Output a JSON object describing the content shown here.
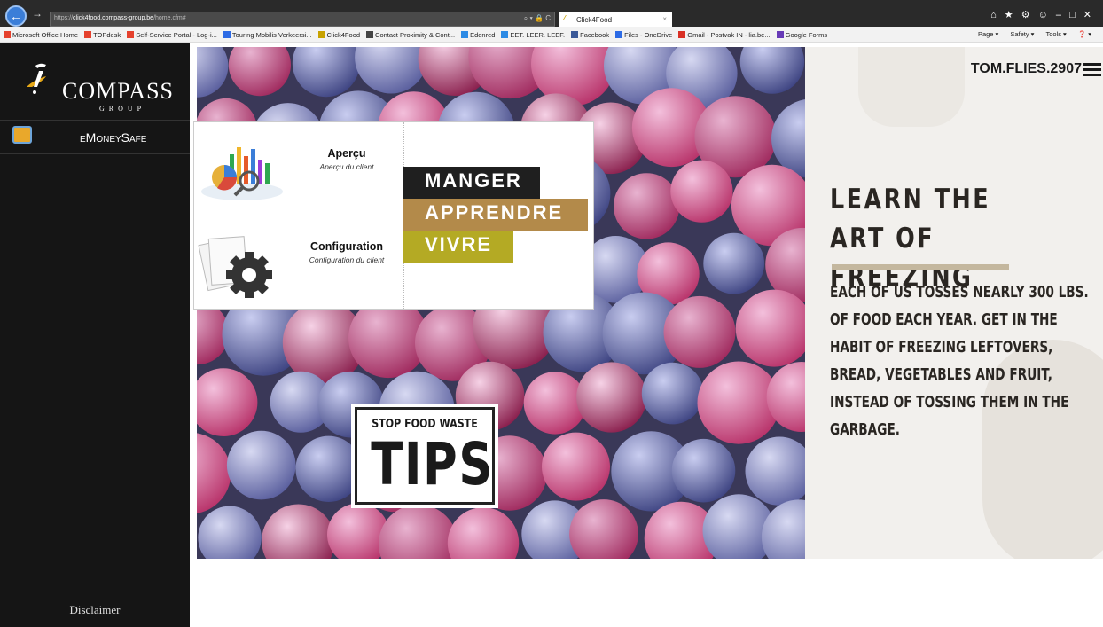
{
  "browser": {
    "address_prefix": "https://",
    "address_host": "click4food.compass-group.be",
    "address_path": "/home.cfm#",
    "address_controls": "⌕ ▾ 🔒 C",
    "tab_title": "Click4Food",
    "tab_close": "×",
    "window_controls": "⌂ ★ ⚙ ☺ – □ ✕",
    "back_glyph": "←",
    "forward_glyph": "→",
    "favorites": [
      "Microsoft Office Home",
      "TOPdesk",
      "Self-Service Portal - Log-i...",
      "Touring Mobilis Verkeersi...",
      "Click4Food",
      "Contact Proximity & Cont...",
      "Edenred",
      "EET. LEER. LEEF.",
      "Facebook",
      "Files - OneDrive",
      "Gmail - Postvak IN - lia.be...",
      "Google Forms"
    ],
    "favorite_icon_colors": [
      "#e5412d",
      "#e5412d",
      "#e5412d",
      "#2d6be5",
      "#c8a200",
      "#444444",
      "#2d8be5",
      "#2d8be5",
      "#3b5998",
      "#2d6be5",
      "#d93025",
      "#673ab7"
    ],
    "tools": [
      "Page ▾",
      "Safety ▾",
      "Tools ▾",
      "❓ ▾"
    ]
  },
  "sidebar": {
    "brand_name": "COMPASS",
    "brand_sub": "GROUP",
    "nav_item": "eMoneySafe",
    "disclaimer": "Disclaimer"
  },
  "menu": {
    "tiles": [
      {
        "title": "Aperçu",
        "subtitle": "Aperçu du client"
      },
      {
        "title": "Configuration",
        "subtitle": "Configuration du client"
      }
    ]
  },
  "hero": {
    "brand_words": [
      "MANGER",
      "APPRENDRE",
      "VIVRE"
    ],
    "brand_colors": [
      "#1f1f1f",
      "#b38a4a",
      "#b4aa24"
    ],
    "tips_small": "STOP FOOD WASTE",
    "tips_big": "TIPS"
  },
  "promo": {
    "username": "TOM.FLIES.2907",
    "headline": "LEARN THE ART OF FREEZING",
    "body": "EACH OF US TOSSES NEARLY 300 LBS. OF FOOD EACH YEAR. GET IN THE HABIT OF FREEZING LEFTOVERS, BREAD, VEGETABLES AND FRUIT, INSTEAD OF TOSSING THEM IN THE GARBAGE.",
    "rule_color": "#c4b79e"
  }
}
